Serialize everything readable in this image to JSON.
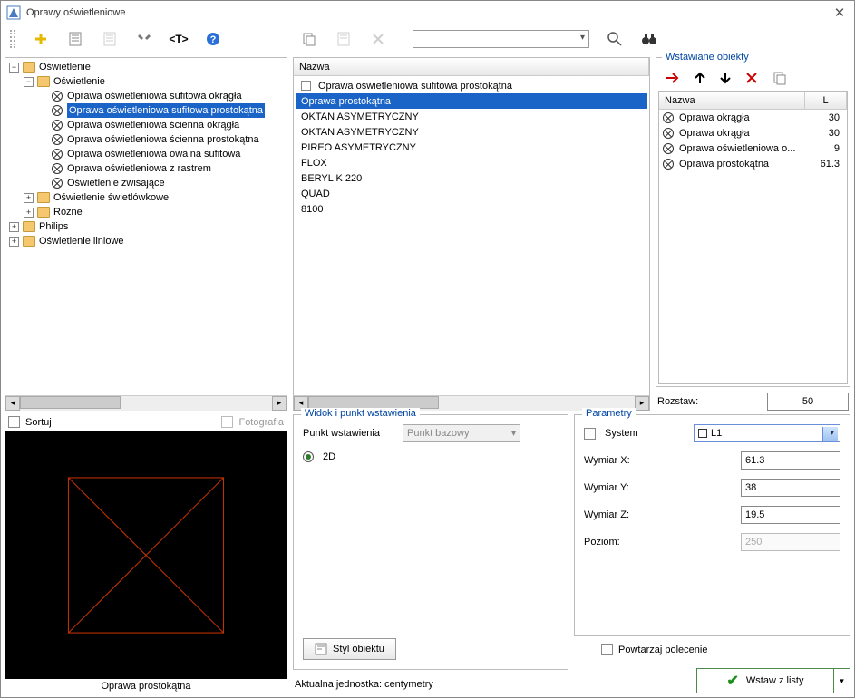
{
  "window": {
    "title": "Oprawy oświetleniowe"
  },
  "tree": {
    "root": "Oświetlenie",
    "level2": "Oświetlenie",
    "items": [
      "Oprawa oświetleniowa sufitowa okrągła",
      "Oprawa oświetleniowa sufitowa prostokątna",
      "Oprawa oświetleniowa ścienna okrągła",
      "Oprawa oświetleniowa ścienna prostokątna",
      "Oprawa oświetleniowa owalna sufitowa",
      "Oprawa oświetleniowa z rastrem",
      "Oświetlenie zwisające"
    ],
    "siblings": [
      "Oświetlenie świetlówkowe",
      "Różne"
    ],
    "roots2": [
      "Philips",
      "Oświetlenie liniowe"
    ]
  },
  "names": {
    "header": "Nazwa",
    "rows": [
      "Oprawa oświetleniowa sufitowa prostokątna",
      "Oprawa prostokątna",
      "OKTAN ASYMETRYCZNY",
      "OKTAN ASYMETRYCZNY",
      "PIREO ASYMETRYCZNY",
      "FLOX",
      "BERYL K 220",
      "QUAD",
      "8100"
    ],
    "selectedIndex": 1
  },
  "objects": {
    "title": "Wstawiane obiekty",
    "cols": {
      "name": "Nazwa",
      "val": "L"
    },
    "rows": [
      {
        "n": "Oprawa okrągła",
        "v": "30"
      },
      {
        "n": "Oprawa okrągła",
        "v": "30"
      },
      {
        "n": "Oprawa oświetleniowa o...",
        "v": "9"
      },
      {
        "n": "Oprawa prostokątna",
        "v": "61.3"
      }
    ],
    "rozstaw_label": "Rozstaw:",
    "rozstaw_value": "50"
  },
  "preview": {
    "sort": "Sortuj",
    "photo": "Fotografia",
    "caption": "Oprawa prostokątna"
  },
  "insert": {
    "title": "Widok i punkt wstawienia",
    "point_label": "Punkt wstawienia",
    "point_value": "Punkt bazowy",
    "mode_2d": "2D",
    "style_btn": "Styl obiektu",
    "unit": "Aktualna jednostka: centymetry"
  },
  "params": {
    "title": "Parametry",
    "system_label": "System",
    "system_value": "L1",
    "x_label": "Wymiar X:",
    "x_value": "61.3",
    "y_label": "Wymiar Y:",
    "y_value": "38",
    "z_label": "Wymiar Z:",
    "z_value": "19.5",
    "level_label": "Poziom:",
    "level_value": "250"
  },
  "footer": {
    "repeat": "Powtarzaj polecenie",
    "insert_btn": "Wstaw z listy"
  }
}
